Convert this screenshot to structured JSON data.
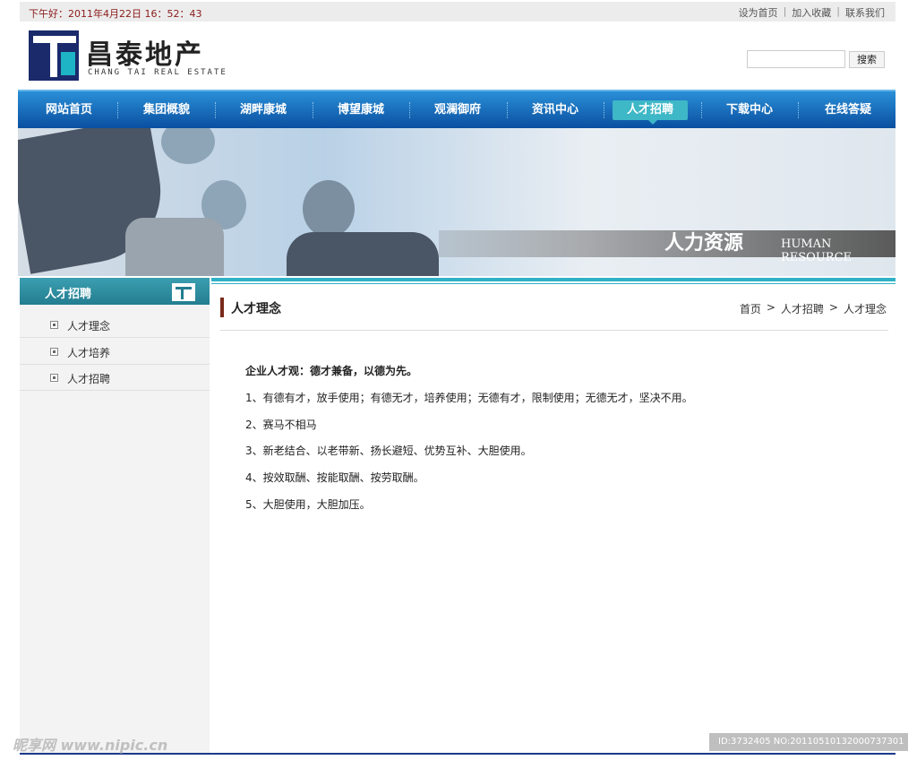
{
  "topbar": {
    "greeting": "下午好：2011年4月22日 16：52：43",
    "links": [
      "设为首页",
      "加入收藏",
      "联系我们"
    ],
    "separator": "|"
  },
  "logo": {
    "cn": "昌泰地产",
    "en": "CHANG TAI REAL ESTATE"
  },
  "search": {
    "button": "搜索"
  },
  "nav": {
    "items": [
      "网站首页",
      "集团概貌",
      "湖畔康城",
      "博望康城",
      "观澜御府",
      "资讯中心",
      "人才招聘",
      "下载中心",
      "在线答疑"
    ],
    "active": "人才招聘"
  },
  "banner": {
    "title": "人力资源",
    "subtitle": "HUMAN RESOURCE"
  },
  "sidebar": {
    "heading": "人才招聘",
    "items": [
      "人才理念",
      "人才培养",
      "人才招聘"
    ]
  },
  "content": {
    "title": "人才理念",
    "breadcrumb": [
      "首页",
      ">",
      "人才招聘",
      ">",
      "人才理念"
    ],
    "paragraphs": [
      "企业人才观：德才兼备，以德为先。",
      "1、有德有才，放手使用；有德无才，培养使用；无德有才，限制使用；无德无才，坚决不用。",
      "2、赛马不相马",
      "3、新老结合、以老带新、扬长避短、优势互补、大胆使用。",
      "4、按效取酬、按能取酬、按劳取酬。",
      "5、大胆使用，大胆加压。"
    ]
  },
  "watermark": {
    "site": "昵享网 www.nipic.cn",
    "id": "ID:3732405 NO:20110510132000737301"
  },
  "colors": {
    "nav": "#0a4fa0",
    "accent": "#2fb1c6",
    "logo": "#1b2a6b"
  }
}
